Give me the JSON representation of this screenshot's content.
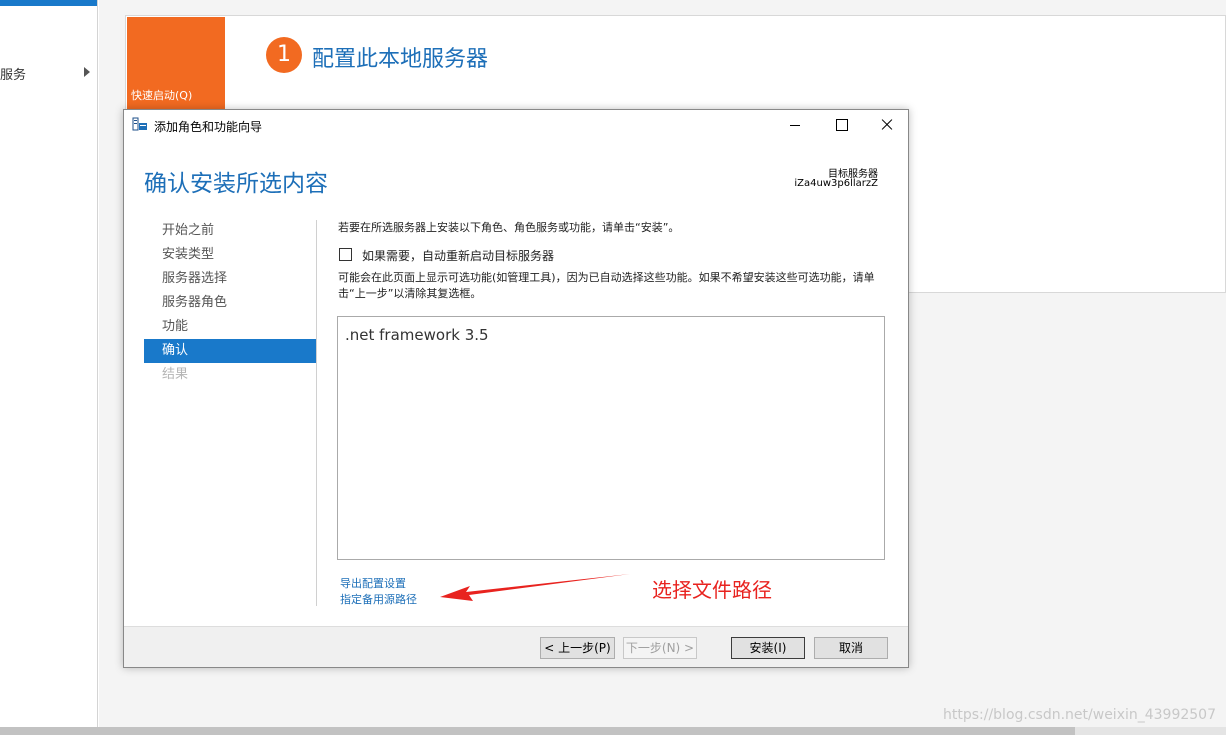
{
  "background": {
    "sidebar": {
      "item_label": "服务"
    },
    "quickstart": {
      "label": "快速启动(Q)"
    },
    "step": {
      "number": "1",
      "title": "配置此本地服务器"
    }
  },
  "wizard": {
    "title": "添加角色和功能向导",
    "heading": "确认安装所选内容",
    "destination_label": "目标服务器",
    "destination_value": "iZa4uw3p6llarzZ",
    "nav": [
      {
        "label": "开始之前",
        "state": "normal"
      },
      {
        "label": "安装类型",
        "state": "normal"
      },
      {
        "label": "服务器选择",
        "state": "normal"
      },
      {
        "label": "服务器角色",
        "state": "normal"
      },
      {
        "label": "功能",
        "state": "normal"
      },
      {
        "label": "确认",
        "state": "active"
      },
      {
        "label": "结果",
        "state": "disabled"
      }
    ],
    "intro": "若要在所选服务器上安装以下角色、角色服务或功能，请单击“安装”。",
    "restart_checkbox": {
      "label": "如果需要，自动重新启动目标服务器",
      "checked": false
    },
    "note": "可能会在此页面上显示可选功能(如管理工具)，因为已自动选择这些功能。如果不希望安装这些可选功能，请单击“上一步”以清除其复选框。",
    "selected_items": [
      ".net framework 3.5"
    ],
    "links": {
      "export": "导出配置设置",
      "alt_source": "指定备用源路径"
    },
    "buttons": {
      "prev": "< 上一步(P)",
      "next": "下一步(N) >",
      "install": "安装(I)",
      "cancel": "取消"
    }
  },
  "annotation": {
    "text": "选择文件路径",
    "color": "#e8231f"
  },
  "watermark": "https://blog.csdn.net/weixin_43992507",
  "colors": {
    "accent": "#1979ca",
    "heading": "#1d6fb8",
    "orange": "#f26a21"
  }
}
